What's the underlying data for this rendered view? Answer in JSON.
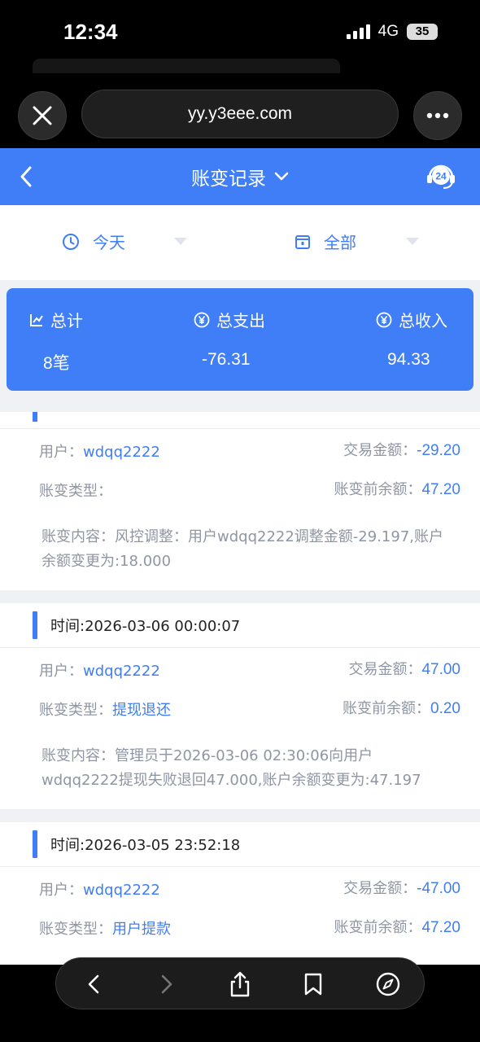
{
  "status_bar": {
    "time": "12:34",
    "network": "4G",
    "battery": "35"
  },
  "browser": {
    "url": "yy.y3eee.com"
  },
  "header": {
    "title": "账变记录",
    "support_badge": "24"
  },
  "filters": {
    "date": "今天",
    "type": "全部"
  },
  "summary": {
    "total_label": "总计",
    "total_value": "8笔",
    "expense_label": "总支出",
    "expense_value": "-76.31",
    "income_label": "总收入",
    "income_value": "94.33"
  },
  "labels": {
    "user": "用户：",
    "amount": "交易金额：",
    "type": "账变类型：",
    "balance_before": "账变前余额：",
    "content": "账变内容："
  },
  "records": [
    {
      "time": "",
      "user": "wdqq2222",
      "amount": "-29.20",
      "type": "",
      "balance_before": "47.20",
      "content": "风控调整：用户wdqq2222调整金额-29.197,账户余额变更为:18.000"
    },
    {
      "time": "时间:2026-03-06 00:00:07",
      "user": "wdqq2222",
      "amount": "47.00",
      "type": "提现退还",
      "balance_before": "0.20",
      "content": "管理员于2026-03-06 02:30:06向用户wdqq2222提现失败退回47.000,账户余额变更为:47.197"
    },
    {
      "time": "时间:2026-03-05 23:52:18",
      "user": "wdqq2222",
      "amount": "-47.00",
      "type": "用户提款",
      "balance_before": "47.20",
      "content": ""
    }
  ],
  "colors": {
    "primary": "#3f7ef6",
    "label_gray": "#8f96a3",
    "page_bg": "#eff1f5"
  }
}
